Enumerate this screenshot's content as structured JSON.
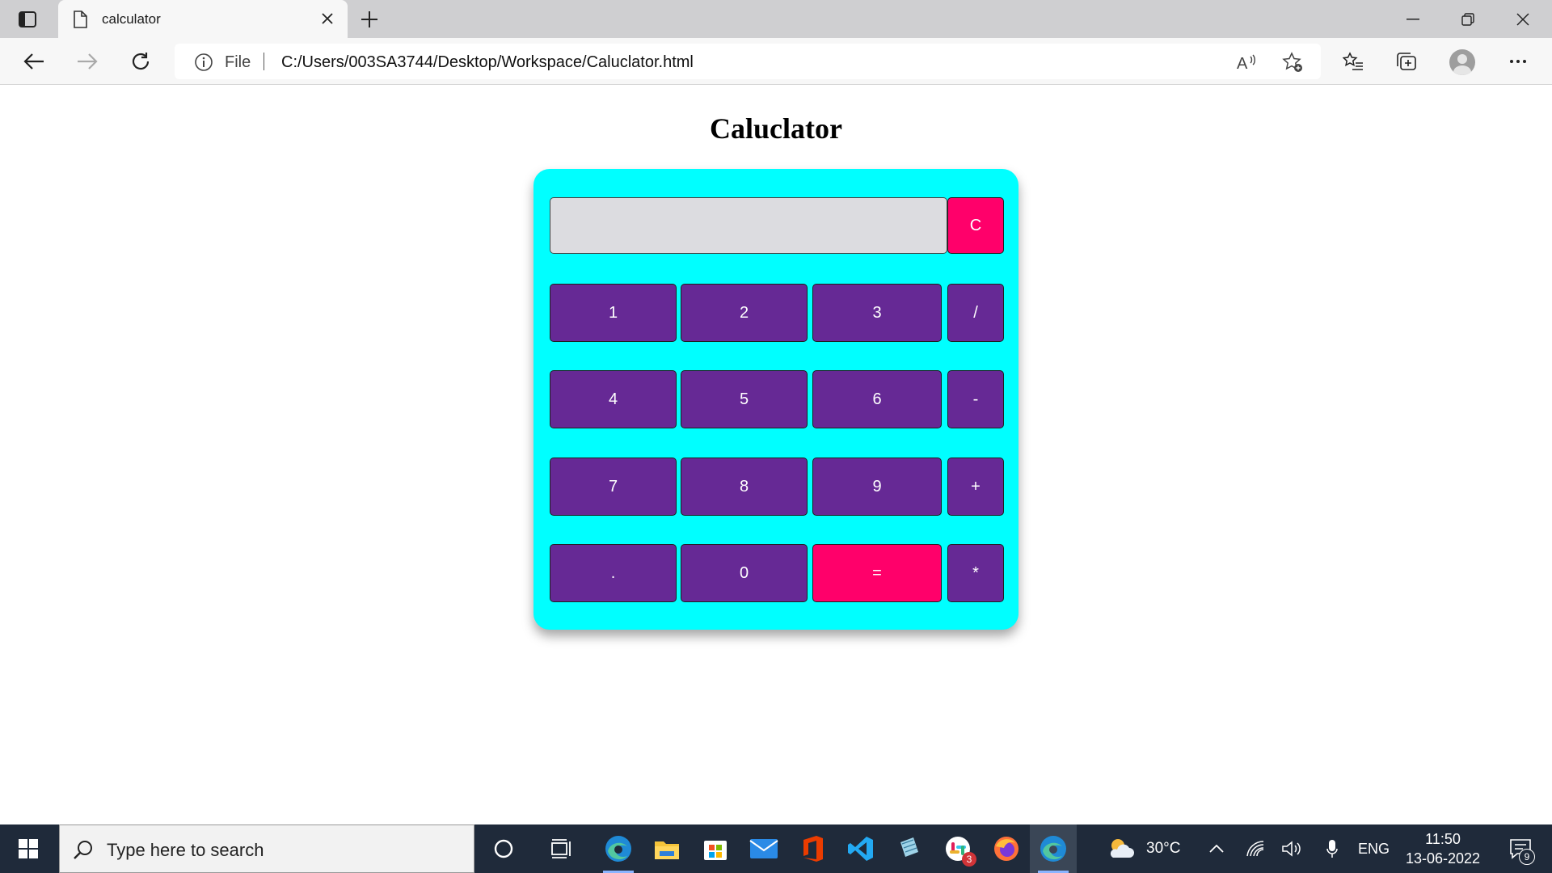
{
  "browser": {
    "tab_title": "calculator",
    "url_scheme": "File",
    "url": "C:/Users/003SA3744/Desktop/Workspace/Caluclator.html"
  },
  "page": {
    "heading": "Caluclator",
    "display_value": "",
    "clear_label": "C",
    "keys": [
      [
        "1",
        "2",
        "3",
        "/"
      ],
      [
        "4",
        "5",
        "6",
        "-"
      ],
      [
        "7",
        "8",
        "9",
        "+"
      ],
      [
        ".",
        "0",
        "=",
        "*"
      ]
    ],
    "colors": {
      "calculator_bg": "#00ffff",
      "key_bg": "#662995",
      "accent_key_bg": "#ff006a",
      "display_bg": "#dcdce0"
    }
  },
  "taskbar": {
    "search_placeholder": "Type here to search",
    "weather_temp": "30°C",
    "language": "ENG",
    "time": "11:50",
    "date": "13-06-2022",
    "slack_badge": "3",
    "notification_count": "9",
    "apps": [
      "cortana-icon",
      "task-view-icon",
      "edge-icon",
      "file-explorer-icon",
      "microsoft-store-icon",
      "mail-icon",
      "office-icon",
      "vscode-icon",
      "notepad-icon",
      "slack-icon",
      "firefox-icon",
      "edge-active-icon"
    ]
  }
}
